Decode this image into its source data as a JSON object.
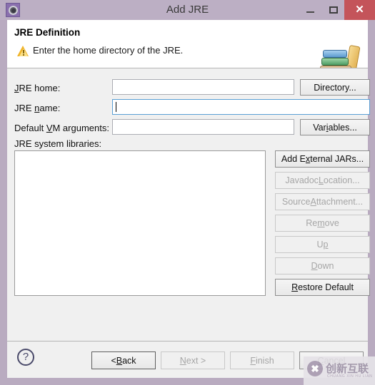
{
  "window": {
    "title": "Add JRE",
    "icon": "gear-icon",
    "controls": {
      "minimize": "–",
      "maximize": "□",
      "close": "✕"
    },
    "frame_color": "#b9abc0",
    "titlebar_color": "#bcafc4",
    "close_color": "#c4545a"
  },
  "header": {
    "title": "JRE Definition",
    "message": "Enter the home directory of the JRE.",
    "status_icon": "warning-icon",
    "decoration_icon": "books-icon",
    "warning_color": "#f0b429"
  },
  "form": {
    "jre_home": {
      "label_pre": "J",
      "label_post": "RE home:",
      "value": "",
      "button": "Directory..."
    },
    "jre_name": {
      "label_pre": "JRE ",
      "label_mn": "n",
      "label_post": "ame:",
      "value": "",
      "focused": true
    },
    "vm_args": {
      "label_pre": "Default ",
      "label_mn": "V",
      "label_post": "M arguments:",
      "value": "",
      "button_pre": "Var",
      "button_mn": "i",
      "button_post": "ables..."
    },
    "libraries": {
      "label": "JRE system libraries:",
      "items": []
    }
  },
  "side_buttons": [
    {
      "pre": "Add E",
      "mn": "x",
      "post": "ternal JARs...",
      "enabled": true
    },
    {
      "pre": "Javadoc ",
      "mn": "L",
      "post": "ocation...",
      "enabled": false
    },
    {
      "pre": "Source ",
      "mn": "A",
      "post": "ttachment...",
      "enabled": false
    },
    {
      "pre": "Re",
      "mn": "m",
      "post": "ove",
      "enabled": false
    },
    {
      "pre": "U",
      "mn": "p",
      "post": "",
      "enabled": false
    },
    {
      "pre": "",
      "mn": "D",
      "post": "own",
      "enabled": false
    },
    {
      "pre": "",
      "mn": "R",
      "post": "estore Default",
      "enabled": true
    }
  ],
  "footer": {
    "help_icon": "?",
    "buttons": [
      {
        "pre": "< ",
        "mn": "B",
        "post": "ack",
        "enabled": true,
        "default": true
      },
      {
        "pre": "",
        "mn": "N",
        "post": "ext >",
        "enabled": false,
        "default": false
      },
      {
        "pre": "",
        "mn": "F",
        "post": "inish",
        "enabled": false,
        "default": false
      },
      {
        "pre": "",
        "mn": "C",
        "post": "ancel",
        "enabled": true,
        "default": false
      }
    ]
  },
  "watermark": {
    "logo": "✖",
    "text_cn": "创新互联",
    "text_py": "CHUANG XIN HU LIAN"
  }
}
